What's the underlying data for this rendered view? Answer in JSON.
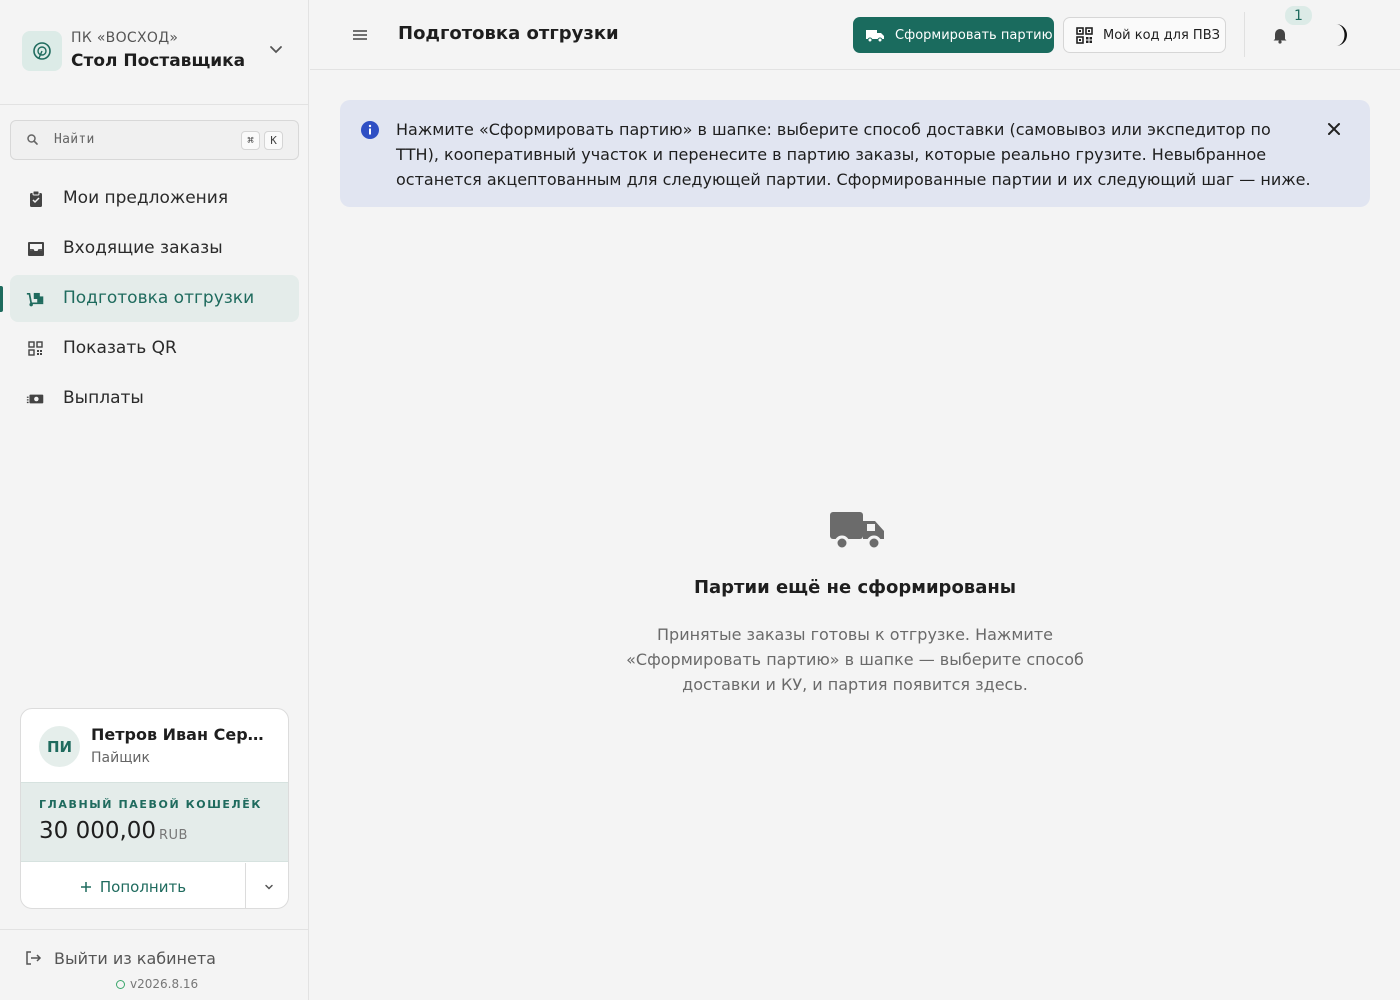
{
  "org": {
    "subtitle": "ПК «ВОСХОД»",
    "title": "Стол Поставщика"
  },
  "search": {
    "placeholder": "Найти",
    "kbd1": "⌘",
    "kbd2": "K"
  },
  "sidebar": {
    "items": [
      {
        "label": "Мои предложения",
        "icon": "clipboard-icon"
      },
      {
        "label": "Входящие заказы",
        "icon": "inbox-icon"
      },
      {
        "label": "Подготовка отгрузки",
        "icon": "dolly-icon",
        "active": true
      },
      {
        "label": "Показать QR",
        "icon": "qr-icon"
      },
      {
        "label": "Выплаты",
        "icon": "money-icon"
      }
    ]
  },
  "user": {
    "initials": "ПИ",
    "name": "Петров Иван Сергеевич",
    "role": "Пайщик",
    "wallet_label": "ГЛАВНЫЙ ПАЕВОЙ КОШЕЛЁК",
    "wallet_amount": "30 000,00",
    "wallet_currency": "RUB",
    "topup_label": "Пополнить"
  },
  "footer": {
    "logout_label": "Выйти из кабинета",
    "version": "v2026.8.16"
  },
  "header": {
    "title": "Подготовка отгрузки",
    "primary_button": "Сформировать партию",
    "secondary_button": "Мой код для ПВЗ",
    "notifications_count": "1"
  },
  "alert": {
    "text": "Нажмите «Сформировать партию» в шапке: выберите способ доставки (самовывоз или экспедитор по ТТН), кооперативный участок и перенесите в партию заказы, которые реально грузите. Невыбранное останется акцептованным для следующей партии. Сформированные партии и их следующий шаг — ниже."
  },
  "empty": {
    "title": "Партии ещё не сформированы",
    "description": "Принятые заказы готовы к отгрузке. Нажмите «Сформировать партию» в шапке — выберите способ доставки и КУ, и партия появится здесь."
  },
  "colors": {
    "accent": "#1a6b5e",
    "alert_bg": "#e1e5f1",
    "info": "#2f4fc4"
  }
}
